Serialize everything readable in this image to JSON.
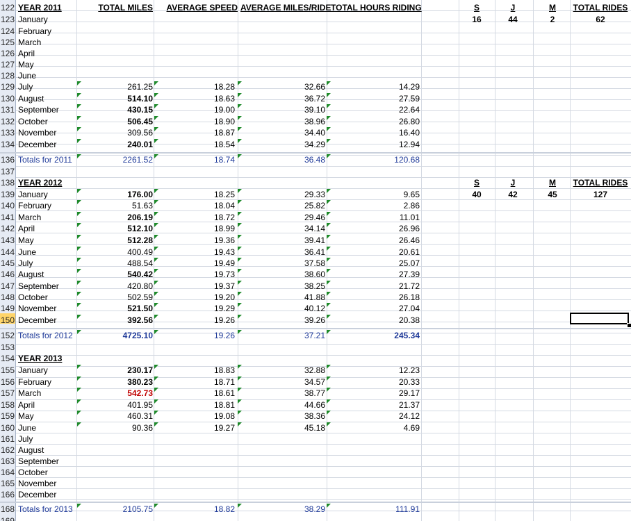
{
  "headers": {
    "total_miles": "TOTAL MILES",
    "avg_speed": "AVERAGE SPEED",
    "avg_miles_ride": "AVERAGE MILES/RIDE",
    "total_hours": "TOTAL HOURS RIDING"
  },
  "summary_2011": {
    "s": "S",
    "j": "J",
    "m": "M",
    "total": "TOTAL RIDES",
    "s_val": "16",
    "j_val": "44",
    "m_val": "2",
    "total_val": "62"
  },
  "summary_2012": {
    "s": "S",
    "j": "J",
    "m": "M",
    "total": "TOTAL RIDES",
    "s_val": "40",
    "j_val": "42",
    "m_val": "45",
    "total_val": "127"
  },
  "rows": [
    {
      "n": "122",
      "label": "YEAR 2011",
      "y": true
    },
    {
      "n": "123",
      "label": "January"
    },
    {
      "n": "124",
      "label": "February"
    },
    {
      "n": "125",
      "label": "March"
    },
    {
      "n": "126",
      "label": "April"
    },
    {
      "n": "127",
      "label": "May"
    },
    {
      "n": "128",
      "label": "June"
    },
    {
      "n": "129",
      "label": "July",
      "v": [
        "261.25",
        "18.28",
        "32.66",
        "14.29"
      ]
    },
    {
      "n": "130",
      "label": "August",
      "v": [
        "514.10",
        "18.63",
        "36.72",
        "27.59"
      ],
      "bold": true
    },
    {
      "n": "131",
      "label": "September",
      "v": [
        "430.15",
        "19.00",
        "39.10",
        "22.64"
      ],
      "bold": true
    },
    {
      "n": "132",
      "label": "October",
      "v": [
        "506.45",
        "18.90",
        "38.96",
        "26.80"
      ],
      "bold": true
    },
    {
      "n": "133",
      "label": "November",
      "v": [
        "309.56",
        "18.87",
        "34.40",
        "16.40"
      ]
    },
    {
      "n": "134",
      "label": "December",
      "v": [
        "240.01",
        "18.54",
        "34.29",
        "12.94"
      ],
      "bold": true
    },
    {
      "n": "136",
      "label": "Totals for 2011",
      "v": [
        "2261.52",
        "18.74",
        "36.48",
        "120.68"
      ],
      "total": true
    },
    {
      "n": "137",
      "label": ""
    },
    {
      "n": "138",
      "label": "YEAR 2012",
      "y": true
    },
    {
      "n": "139",
      "label": "January",
      "v": [
        "176.00",
        "18.25",
        "29.33",
        "9.65"
      ],
      "bold": true
    },
    {
      "n": "140",
      "label": "February",
      "v": [
        "51.63",
        "18.04",
        "25.82",
        "2.86"
      ]
    },
    {
      "n": "141",
      "label": "March",
      "v": [
        "206.19",
        "18.72",
        "29.46",
        "11.01"
      ],
      "bold": true
    },
    {
      "n": "142",
      "label": "April",
      "v": [
        "512.10",
        "18.99",
        "34.14",
        "26.96"
      ],
      "bold": true
    },
    {
      "n": "143",
      "label": "May",
      "v": [
        "512.28",
        "19.36",
        "39.41",
        "26.46"
      ],
      "bold": true
    },
    {
      "n": "144",
      "label": "June",
      "v": [
        "400.49",
        "19.43",
        "36.41",
        "20.61"
      ]
    },
    {
      "n": "145",
      "label": "July",
      "v": [
        "488.54",
        "19.49",
        "37.58",
        "25.07"
      ]
    },
    {
      "n": "146",
      "label": "August",
      "v": [
        "540.42",
        "19.73",
        "38.60",
        "27.39"
      ],
      "bold": true
    },
    {
      "n": "147",
      "label": "September",
      "v": [
        "420.80",
        "19.37",
        "38.25",
        "21.72"
      ]
    },
    {
      "n": "148",
      "label": "October",
      "v": [
        "502.59",
        "19.20",
        "41.88",
        "26.18"
      ]
    },
    {
      "n": "149",
      "label": "November",
      "v": [
        "521.50",
        "19.29",
        "40.12",
        "27.04"
      ],
      "bold": true
    },
    {
      "n": "150",
      "label": "December",
      "v": [
        "392.56",
        "19.26",
        "39.26",
        "20.38"
      ],
      "bold": true
    },
    {
      "n": "152",
      "label": "Totals for 2012",
      "v": [
        "4725.10",
        "19.26",
        "37.21",
        "245.34"
      ],
      "total": true,
      "bold": true
    },
    {
      "n": "153",
      "label": ""
    },
    {
      "n": "154",
      "label": "YEAR 2013",
      "y": true
    },
    {
      "n": "155",
      "label": "January",
      "v": [
        "230.17",
        "18.83",
        "32.88",
        "12.23"
      ],
      "bold": true
    },
    {
      "n": "156",
      "label": "February",
      "v": [
        "380.23",
        "18.71",
        "34.57",
        "20.33"
      ],
      "bold": true
    },
    {
      "n": "157",
      "label": "March",
      "v": [
        "542.73",
        "18.61",
        "38.77",
        "29.17"
      ],
      "bold": true,
      "red": true
    },
    {
      "n": "158",
      "label": "April",
      "v": [
        "401.95",
        "18.81",
        "44.66",
        "21.37"
      ]
    },
    {
      "n": "159",
      "label": "May",
      "v": [
        "460.31",
        "19.08",
        "38.36",
        "24.12"
      ]
    },
    {
      "n": "160",
      "label": "June",
      "v": [
        "90.36",
        "19.27",
        "45.18",
        "4.69"
      ]
    },
    {
      "n": "161",
      "label": "July"
    },
    {
      "n": "162",
      "label": "August"
    },
    {
      "n": "163",
      "label": "September"
    },
    {
      "n": "164",
      "label": "October"
    },
    {
      "n": "165",
      "label": "November"
    },
    {
      "n": "166",
      "label": "December"
    },
    {
      "n": "168",
      "label": "Totals for 2013",
      "v": [
        "2105.75",
        "18.82",
        "38.29",
        "111.91"
      ],
      "total": true
    },
    {
      "n": "169",
      "label": ""
    }
  ]
}
